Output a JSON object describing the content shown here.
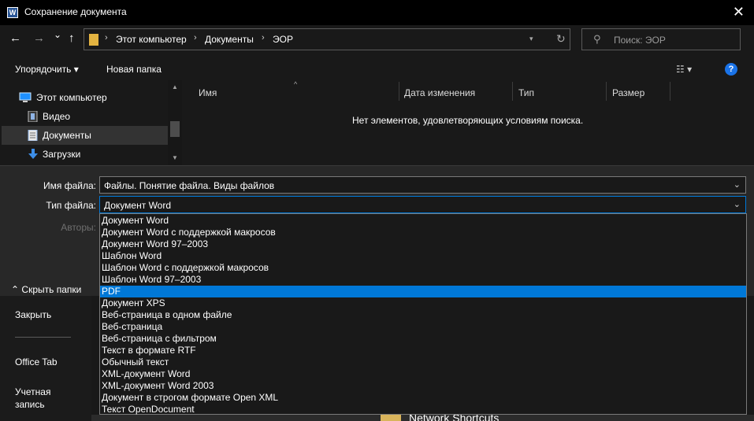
{
  "background": {
    "sidebar_items": [
      "Закрыть",
      "Office Tab",
      "Учетная",
      "запись"
    ],
    "network_item": "Network Shortcuts"
  },
  "window": {
    "title": "Сохранение документа",
    "app_icon": "word-icon",
    "close": "✕"
  },
  "nav": {
    "back": "←",
    "forward": "→",
    "history": "⌄",
    "up": "↑",
    "breadcrumb": [
      "Этот компьютер",
      "Документы",
      "ЭОР"
    ],
    "refresh": "↻",
    "search_placeholder": "Поиск: ЭОР"
  },
  "toolbar": {
    "organize": "Упорядочить ▾",
    "new_folder": "Новая папка",
    "help": "?"
  },
  "nav_pane": {
    "items": [
      {
        "label": "Этот компьютер",
        "icon": "computer-icon"
      },
      {
        "label": "Видео",
        "icon": "video-icon"
      },
      {
        "label": "Документы",
        "icon": "documents-icon",
        "selected": true
      },
      {
        "label": "Загрузки",
        "icon": "downloads-icon"
      }
    ]
  },
  "file_list": {
    "columns": [
      "Имя",
      "Дата изменения",
      "Тип",
      "Размер"
    ],
    "empty_message": "Нет элементов, удовлетворяющих условиям поиска."
  },
  "form": {
    "filename_label": "Имя файла:",
    "filename_value": "Файлы. Понятие файла. Виды файлов",
    "filetype_label": "Тип файла:",
    "filetype_value": "Документ Word",
    "authors_label": "Авторы:",
    "hide_folders": "Скрыть папки"
  },
  "filetype_options": [
    "Документ Word",
    "Документ Word с поддержкой макросов",
    "Документ Word 97–2003",
    "Шаблон Word",
    "Шаблон Word с поддержкой макросов",
    "Шаблон Word 97–2003",
    "PDF",
    "Документ XPS",
    "Веб-страница в одном файле",
    "Веб-страница",
    "Веб-страница с фильтром",
    "Текст в формате RTF",
    "Обычный текст",
    "XML-документ Word",
    "XML-документ Word 2003",
    "Документ в строгом формате Open XML",
    "Текст OpenDocument"
  ],
  "highlighted_option": "PDF",
  "colors": {
    "accent": "#0078d7",
    "folder": "#e3b341"
  }
}
